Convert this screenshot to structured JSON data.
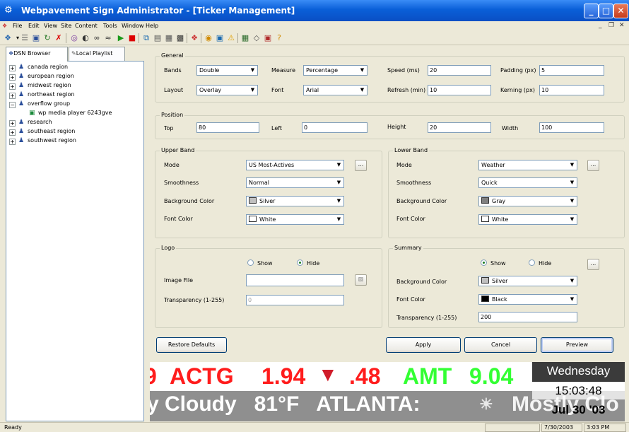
{
  "window": {
    "title": "Webpavement Sign Administrator - [Ticker Management]",
    "title_color": "#0a5fd8"
  },
  "menu": [
    "File",
    "Edit",
    "View",
    "Site",
    "Content",
    "Tools",
    "Window",
    "Help"
  ],
  "left_pane": {
    "tabs": [
      "DSN Browser",
      "Local Playlist"
    ],
    "tree": [
      {
        "label": "canada region",
        "expandable": true
      },
      {
        "label": "european region",
        "expandable": true
      },
      {
        "label": "midwest region",
        "expandable": true
      },
      {
        "label": "northeast region",
        "expandable": true
      },
      {
        "label": "overflow group",
        "expandable": true,
        "expanded": true
      },
      {
        "label": "wp media player 6243gve",
        "child": true
      },
      {
        "label": "research",
        "expandable": true
      },
      {
        "label": "southeast region",
        "expandable": true
      },
      {
        "label": "southwest region",
        "expandable": true
      }
    ]
  },
  "general": {
    "title": "General",
    "bands_label": "Bands",
    "bands_value": "Double",
    "measure_label": "Measure",
    "measure_value": "Percentage",
    "speed_label": "Speed (ms)",
    "speed_value": "20",
    "padding_label": "Padding (px)",
    "padding_value": "5",
    "layout_label": "Layout",
    "layout_value": "Overlay",
    "font_label": "Font",
    "font_value": "Arial",
    "refresh_label": "Refresh (min)",
    "refresh_value": "10",
    "kerning_label": "Kerning (px)",
    "kerning_value": "10"
  },
  "position": {
    "title": "Position",
    "top_label": "Top",
    "top_value": "80",
    "left_label": "Left",
    "left_value": "0",
    "height_label": "Height",
    "height_value": "20",
    "width_label": "Width",
    "width_value": "100"
  },
  "upper_band": {
    "title": "Upper Band",
    "mode_label": "Mode",
    "mode_value": "US Most-Actives",
    "smooth_label": "Smoothness",
    "smooth_value": "Normal",
    "bg_label": "Background Color",
    "bg_value": "Silver",
    "bg_color": "#c0c0c0",
    "fc_label": "Font Color",
    "fc_value": "White",
    "fc_color": "#ffffff",
    "browse": "..."
  },
  "lower_band": {
    "title": "Lower Band",
    "mode_label": "Mode",
    "mode_value": "Weather",
    "smooth_label": "Smoothness",
    "smooth_value": "Quick",
    "bg_label": "Background Color",
    "bg_value": "Gray",
    "bg_color": "#808080",
    "fc_label": "Font Color",
    "fc_value": "White",
    "fc_color": "#ffffff",
    "browse": "..."
  },
  "logo": {
    "title": "Logo",
    "show_label": "Show",
    "hide_label": "Hide",
    "selected": "Hide",
    "image_label": "Image File",
    "image_value": "",
    "transparency_label": "Transparency (1-255)",
    "transparency_value": "0"
  },
  "summary": {
    "title": "Summary",
    "show_label": "Show",
    "hide_label": "Hide",
    "selected": "Show",
    "bg_label": "Background Color",
    "bg_value": "Silver",
    "bg_color": "#c0c0c0",
    "fc_label": "Font Color",
    "fc_value": "Black",
    "fc_color": "#000000",
    "transparency_label": "Transparency (1-255)",
    "transparency_value": "200",
    "browse": "..."
  },
  "buttons": {
    "restore": "Restore Defaults",
    "apply": "Apply",
    "cancel": "Cancel",
    "preview": "Preview"
  },
  "ticker": {
    "upper_segments": [
      "9",
      "ACTG",
      "1.94",
      ".48",
      "AMT",
      "9.04"
    ],
    "lower_text": "y Cloudy   81°F   ATLANTA:",
    "lower_tail": "Mostly Clo",
    "day": "Wednesday",
    "time": "15:03:48",
    "date": "Jul 30 '03",
    "colors": {
      "red": "#ff1c1c",
      "green": "#33ff33",
      "down_arrow": "#d01c2a"
    }
  },
  "status": {
    "text": "Ready",
    "date": "7/30/2003",
    "time": "3:03 PM"
  }
}
